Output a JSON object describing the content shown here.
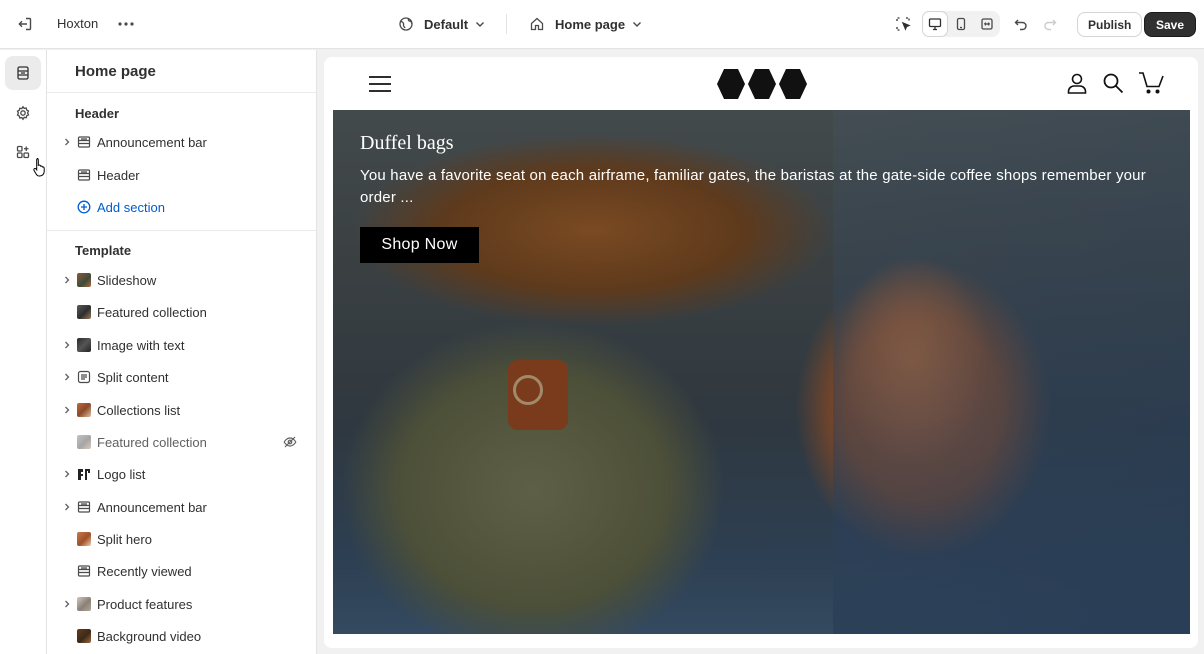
{
  "topbar": {
    "store_name": "Hoxton",
    "theme": "Default",
    "page": "Home page",
    "publish_label": "Publish",
    "save_label": "Save"
  },
  "panel": {
    "title": "Home page",
    "header_group": {
      "title": "Header",
      "items": [
        {
          "label": "Announcement bar",
          "icon": "section-icon",
          "expandable": true
        },
        {
          "label": "Header",
          "icon": "section-icon",
          "expandable": false
        }
      ],
      "add_label": "Add section"
    },
    "template_group": {
      "title": "Template",
      "items": [
        {
          "label": "Slideshow",
          "icon": "image-thumb",
          "expandable": true
        },
        {
          "label": "Featured collection",
          "icon": "image-thumb",
          "expandable": false
        },
        {
          "label": "Image with text",
          "icon": "image-thumb",
          "expandable": true
        },
        {
          "label": "Split content",
          "icon": "text-icon",
          "expandable": true
        },
        {
          "label": "Collections list",
          "icon": "image-thumb",
          "expandable": true
        },
        {
          "label": "Featured collection",
          "icon": "image-thumb",
          "expandable": false,
          "hidden": true
        },
        {
          "label": "Logo list",
          "icon": "logo-thumb",
          "expandable": true
        },
        {
          "label": "Announcement bar",
          "icon": "section-icon",
          "expandable": true
        },
        {
          "label": "Split hero",
          "icon": "image-thumb",
          "expandable": false
        },
        {
          "label": "Recently viewed",
          "icon": "section-icon",
          "expandable": false
        },
        {
          "label": "Product features",
          "icon": "image-thumb",
          "expandable": true
        },
        {
          "label": "Background video",
          "icon": "image-thumb",
          "expandable": false
        }
      ]
    }
  },
  "preview": {
    "hero_title": "Duffel bags",
    "hero_text": "You have a favorite seat on each airframe, familiar gates, the baristas at the gate-side coffee shops remember your order ...",
    "hero_button": "Shop Now"
  },
  "colors": {
    "accent_link": "#005bd3",
    "save_button": "#303030",
    "hero_button": "#000000"
  }
}
